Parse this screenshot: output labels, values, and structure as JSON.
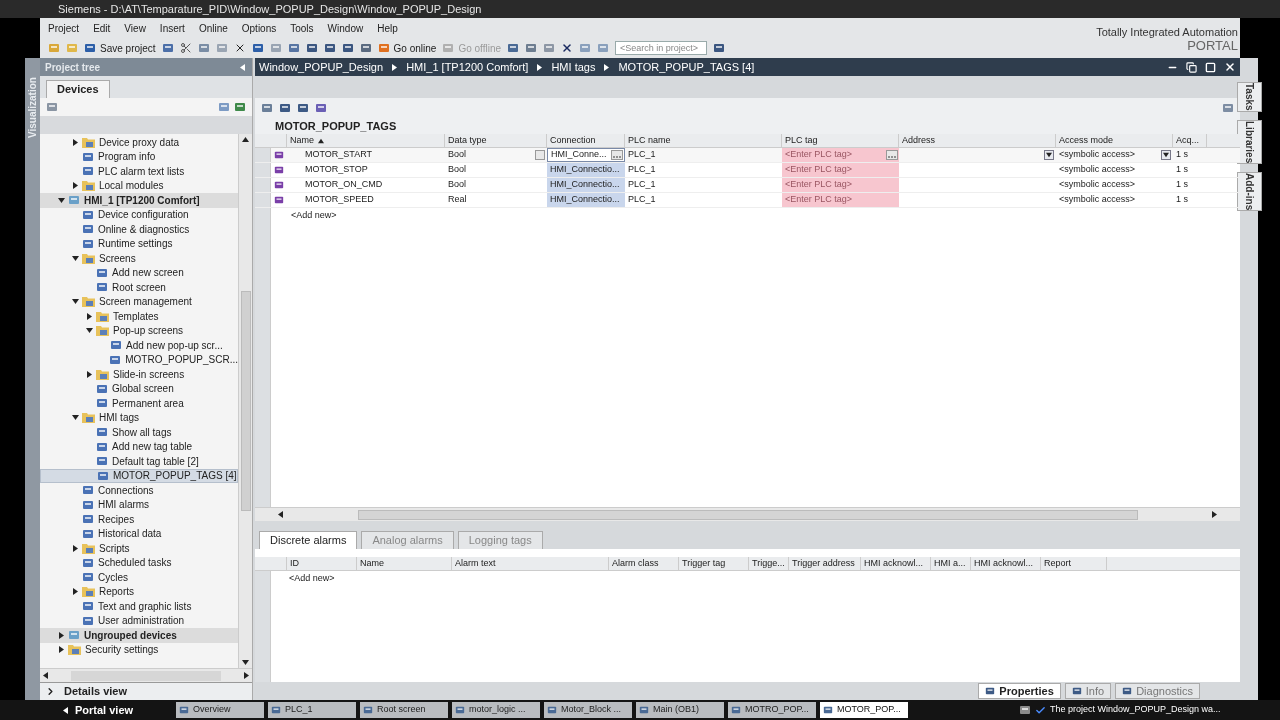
{
  "window": {
    "title": "Siemens - D:\\AT\\Temparature_PID\\Window_POPUP_Design\\Window_POPUP_Design"
  },
  "menu": [
    "Project",
    "Edit",
    "View",
    "Insert",
    "Online",
    "Options",
    "Tools",
    "Window",
    "Help"
  ],
  "toolbar": {
    "save": "Save project",
    "go_online": "Go online",
    "go_offline": {
      "label": "Go offline",
      "disabled": true
    },
    "search": {
      "placeholder": "<Search in project>"
    }
  },
  "brand": {
    "line1": "Totally Integrated Automation",
    "line2": "PORTAL"
  },
  "left_strip": "Visualization",
  "project_tree": {
    "title": "Project tree",
    "tab": "Devices",
    "scrolled_parent_children": [
      {
        "label": "Device proxy data",
        "kind": "folder",
        "expanded": false,
        "selected": false
      },
      {
        "label": "Program info",
        "kind": "item",
        "selected": false
      },
      {
        "label": "PLC alarm text lists",
        "kind": "item",
        "selected": false
      },
      {
        "label": "Local modules",
        "kind": "folder",
        "expanded": false,
        "selected": false
      }
    ],
    "items": [
      {
        "label": "HMI_1 [TP1200 Comfort]",
        "kind": "device",
        "expanded": true,
        "selected": false,
        "children": [
          {
            "label": "Device configuration",
            "kind": "item",
            "selected": false
          },
          {
            "label": "Online & diagnostics",
            "kind": "item",
            "selected": false
          },
          {
            "label": "Runtime settings",
            "kind": "item",
            "selected": false
          },
          {
            "label": "Screens",
            "kind": "folder",
            "expanded": true,
            "selected": false,
            "children": [
              {
                "label": "Add new screen",
                "kind": "item",
                "selected": false
              },
              {
                "label": "Root screen",
                "kind": "item",
                "selected": false
              }
            ]
          },
          {
            "label": "Screen management",
            "kind": "folder",
            "expanded": true,
            "selected": false,
            "children": [
              {
                "label": "Templates",
                "kind": "folder",
                "expanded": false,
                "selected": false
              },
              {
                "label": "Pop-up screens",
                "kind": "folder",
                "expanded": true,
                "selected": false,
                "children": [
                  {
                    "label": "Add new pop-up scr...",
                    "kind": "item",
                    "selected": false
                  },
                  {
                    "label": "MOTRO_POPUP_SCR...",
                    "kind": "item",
                    "selected": false
                  }
                ]
              },
              {
                "label": "Slide-in screens",
                "kind": "folder",
                "expanded": false,
                "selected": false
              },
              {
                "label": "Global screen",
                "kind": "item",
                "selected": false
              },
              {
                "label": "Permanent area",
                "kind": "item",
                "selected": false
              }
            ]
          },
          {
            "label": "HMI tags",
            "kind": "folder",
            "expanded": true,
            "selected": false,
            "children": [
              {
                "label": "Show all tags",
                "kind": "item",
                "selected": false
              },
              {
                "label": "Add new tag table",
                "kind": "item",
                "selected": false
              },
              {
                "label": "Default tag table [2]",
                "kind": "item",
                "selected": false
              },
              {
                "label": "MOTOR_POPUP_TAGS [4]",
                "kind": "item",
                "selected": true
              }
            ]
          },
          {
            "label": "Connections",
            "kind": "item",
            "selected": false
          },
          {
            "label": "HMI alarms",
            "kind": "item",
            "selected": false
          },
          {
            "label": "Recipes",
            "kind": "item",
            "selected": false
          },
          {
            "label": "Historical data",
            "kind": "item",
            "selected": false
          },
          {
            "label": "Scripts",
            "kind": "folder",
            "expanded": false,
            "selected": false
          },
          {
            "label": "Scheduled tasks",
            "kind": "item",
            "selected": false
          },
          {
            "label": "Cycles",
            "kind": "item",
            "selected": false
          },
          {
            "label": "Reports",
            "kind": "folder",
            "expanded": false,
            "selected": false
          },
          {
            "label": "Text and graphic lists",
            "kind": "item",
            "selected": false
          },
          {
            "label": "User administration",
            "kind": "item",
            "selected": false
          }
        ]
      },
      {
        "label": "Ungrouped devices",
        "kind": "device",
        "expanded": false,
        "selected": false
      },
      {
        "label": "Security settings",
        "kind": "folder",
        "expanded": false,
        "selected": false
      }
    ],
    "details_view": "Details view"
  },
  "editor": {
    "breadcrumb": [
      "Window_POPUP_Design",
      "HMI_1 [TP1200 Comfort]",
      "HMI tags",
      "MOTOR_POPUP_TAGS [4]"
    ],
    "table_name": "MOTOR_POPUP_TAGS",
    "columns": [
      "Name",
      "Data type",
      "Connection",
      "PLC name",
      "PLC tag",
      "Address",
      "Access mode",
      "Acq..."
    ],
    "rows": [
      {
        "name": "MOTOR_START",
        "data_type": "Bool",
        "connection": "HMI_Conne...",
        "plc_name": "PLC_1",
        "plc_tag_placeholder": "<Enter PLC tag>",
        "access_mode": "<symbolic access>",
        "acq": "1 s",
        "selected": true,
        "connection_highlighted": false,
        "invalid": true
      },
      {
        "name": "MOTOR_STOP",
        "data_type": "Bool",
        "connection": "HMI_Connectio...",
        "plc_name": "PLC_1",
        "plc_tag_placeholder": "<Enter PLC tag>",
        "access_mode": "<symbolic access>",
        "acq": "1 s",
        "selected": false,
        "connection_highlighted": true,
        "invalid": true
      },
      {
        "name": "MOTOR_ON_CMD",
        "data_type": "Bool",
        "connection": "HMI_Connectio...",
        "plc_name": "PLC_1",
        "plc_tag_placeholder": "<Enter PLC tag>",
        "access_mode": "<symbolic access>",
        "acq": "1 s",
        "selected": false,
        "connection_highlighted": true,
        "invalid": true
      },
      {
        "name": "MOTOR_SPEED",
        "data_type": "Real",
        "connection": "HMI_Connectio...",
        "plc_name": "PLC_1",
        "plc_tag_placeholder": "<Enter PLC tag>",
        "access_mode": "<symbolic access>",
        "acq": "1 s",
        "selected": false,
        "connection_highlighted": true,
        "invalid": true
      }
    ],
    "add_new": "<Add new>",
    "bottom_tabs": [
      {
        "label": "Discrete alarms",
        "selected": true
      },
      {
        "label": "Analog alarms",
        "selected": false
      },
      {
        "label": "Logging tags",
        "selected": false
      }
    ],
    "alarm_columns": [
      "ID",
      "Name",
      "Alarm text",
      "Alarm class",
      "Trigger tag",
      "Trigge...",
      "Trigger address",
      "HMI acknowl...",
      "HMI a...",
      "HMI acknowl...",
      "Report"
    ],
    "alarm_add_new": "<Add new>"
  },
  "right_strip": [
    "Tasks",
    "Libraries",
    "Add-ins"
  ],
  "inspector_tabs": [
    {
      "label": "Properties",
      "selected": true
    },
    {
      "label": "Info",
      "selected": false
    },
    {
      "label": "Diagnostics",
      "selected": false
    }
  ],
  "taskbar": {
    "portal_view": "Portal view",
    "items": [
      {
        "label": "Overview",
        "selected": false
      },
      {
        "label": "PLC_1",
        "selected": false
      },
      {
        "label": "Root screen",
        "selected": false
      },
      {
        "label": "motor_logic ...",
        "selected": false
      },
      {
        "label": "Motor_Block ...",
        "selected": false
      },
      {
        "label": "Main (OB1)",
        "selected": false
      },
      {
        "label": "MOTRO_POP...",
        "selected": false
      },
      {
        "label": "MOTOR_POP...",
        "selected": true
      }
    ],
    "status": "The project Window_POPUP_Design wa..."
  }
}
